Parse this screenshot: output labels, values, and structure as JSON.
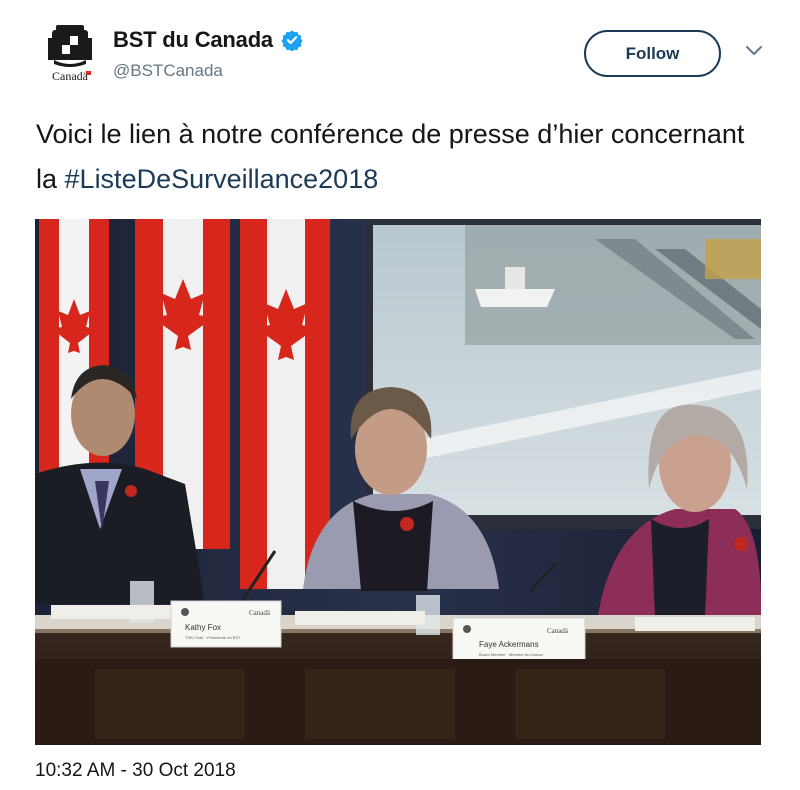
{
  "account": {
    "display_name": "BST du Canada",
    "handle": "@BSTCanada",
    "avatar_caption": "Canadä",
    "verified_icon": "verified-badge-icon",
    "verified_color": "#1da1f2"
  },
  "actions": {
    "follow_label": "Follow",
    "more_icon": "chevron-down-icon"
  },
  "tweet": {
    "text_before": "Voici le lien à notre conférence de presse d’hier concernant la ",
    "hashtag": "#ListeDeSurveillance2018",
    "hashtag_color": "#1b3a57"
  },
  "media": {
    "nameplates": [
      {
        "name": "Kathy Fox",
        "title": "TSB Chair · Présidente du BST"
      },
      {
        "name": "Faye Ackermans",
        "title": "Board Member · Membre du bureau"
      }
    ],
    "nameplate_logo_text": "Canadä"
  },
  "footer": {
    "timestamp": "10:32 AM - 30 Oct 2018"
  }
}
